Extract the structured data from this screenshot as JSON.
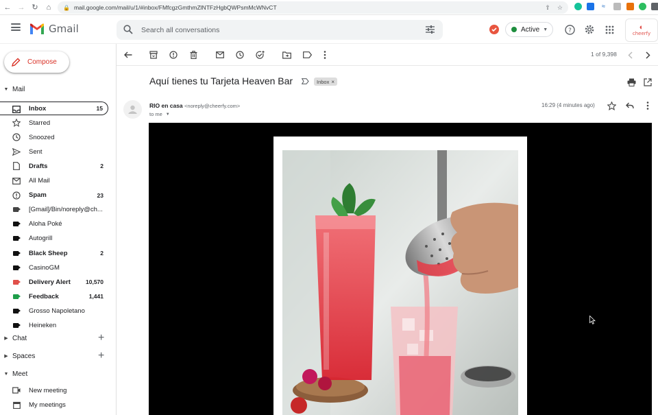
{
  "browser": {
    "url": "mail.google.com/mail/u/1/#inbox/FMfcgzGmthmZlNTFzHgbQWPsmMcWNvCT"
  },
  "header": {
    "app_name": "Gmail",
    "search_placeholder": "Search all conversations",
    "status_label": "Active",
    "brand_logo_text": "cheerfy"
  },
  "sidebar": {
    "compose_label": "Compose",
    "mail_section": "Mail",
    "items": [
      {
        "label": "Inbox",
        "count": "15",
        "bold": true,
        "selected": true,
        "icon": "inbox-icon"
      },
      {
        "label": "Starred",
        "count": "",
        "icon": "star-icon"
      },
      {
        "label": "Snoozed",
        "count": "",
        "icon": "clock-icon"
      },
      {
        "label": "Sent",
        "count": "",
        "icon": "send-icon"
      },
      {
        "label": "Drafts",
        "count": "2",
        "bold": true,
        "icon": "draft-icon"
      },
      {
        "label": "All Mail",
        "count": "",
        "icon": "mail-icon"
      },
      {
        "label": "Spam",
        "count": "23",
        "bold": true,
        "icon": "spam-icon"
      },
      {
        "label": "[Gmail]/Bin/noreply@ch...",
        "count": "",
        "icon": "label-icon",
        "color": "#444444"
      },
      {
        "label": "Aloha Poké",
        "count": "",
        "icon": "label-icon",
        "color": "#111111"
      },
      {
        "label": "Autogrill",
        "count": "",
        "icon": "label-icon",
        "color": "#111111"
      },
      {
        "label": "Black Sheep",
        "count": "2",
        "bold": true,
        "icon": "label-icon",
        "color": "#111111"
      },
      {
        "label": "CasinoGM",
        "count": "",
        "icon": "label-icon",
        "color": "#111111"
      },
      {
        "label": "Delivery Alert",
        "count": "10,570",
        "bold": true,
        "icon": "label-icon",
        "color": "#e0504a"
      },
      {
        "label": "Feedback",
        "count": "1,441",
        "bold": true,
        "icon": "label-icon",
        "color": "#1e9e4a"
      },
      {
        "label": "Grosso Napoletano",
        "count": "",
        "icon": "label-icon",
        "color": "#111111"
      },
      {
        "label": "Heineken",
        "count": "",
        "icon": "label-icon",
        "color": "#111111"
      }
    ],
    "chat_section": "Chat",
    "spaces_section": "Spaces",
    "meet_section": "Meet",
    "meet_items": [
      {
        "label": "New meeting",
        "icon": "video-icon"
      },
      {
        "label": "My meetings",
        "icon": "calendar-icon"
      }
    ]
  },
  "toolbar": {
    "pager": "1 of 9,398"
  },
  "email": {
    "subject": "Aquí tienes tu Tarjeta Heaven Bar",
    "label_chip": "Inbox",
    "sender_name": "RIO en casa",
    "sender_email": "<noreply@cheerfy.com>",
    "recipient": "to me",
    "timestamp": "16:29 (4 minutes ago)"
  }
}
